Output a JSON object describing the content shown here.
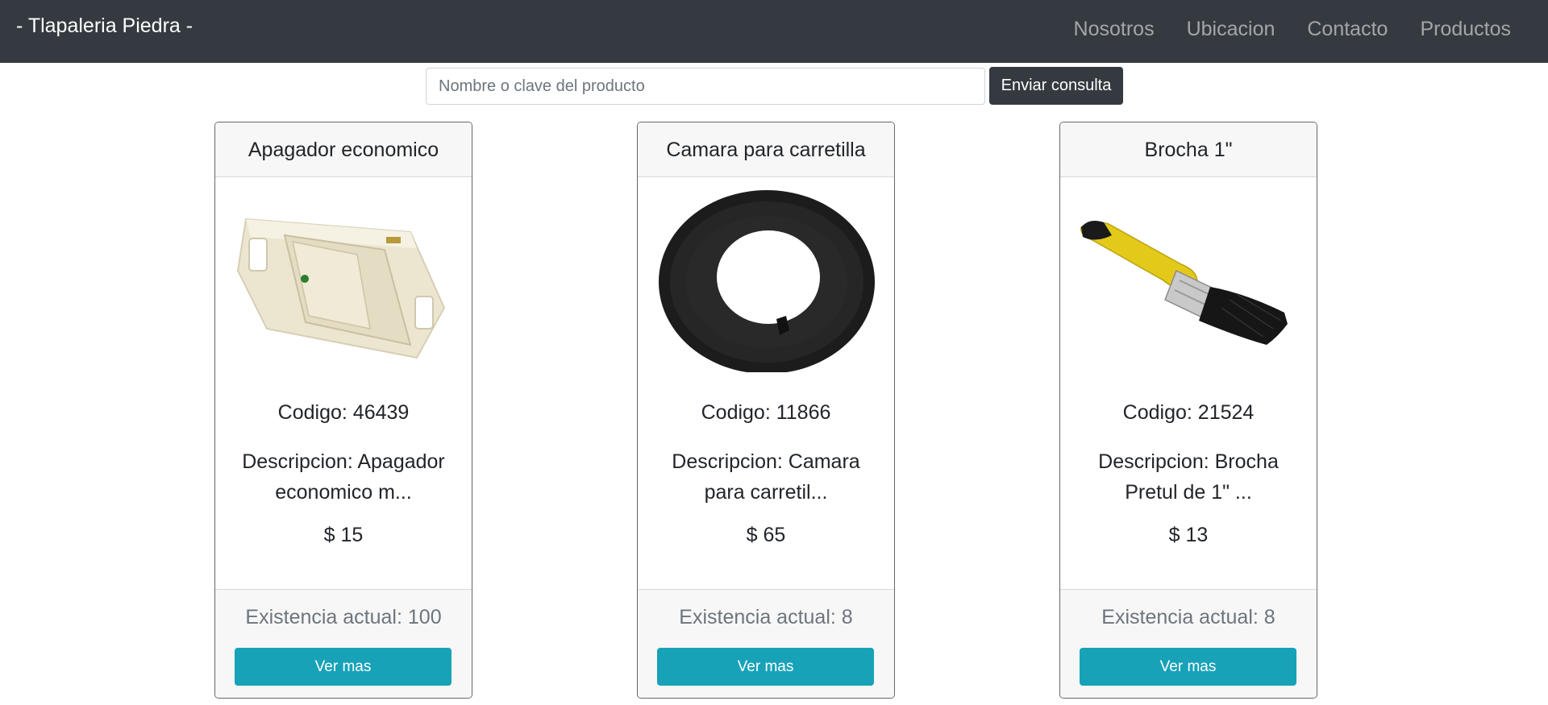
{
  "navbar": {
    "brand": "- Tlapaleria Piedra -",
    "links": [
      "Nosotros",
      "Ubicacion",
      "Contacto",
      "Productos"
    ]
  },
  "search": {
    "placeholder": "Nombre o clave del producto",
    "value": "",
    "button": "Enviar consulta"
  },
  "products": [
    {
      "title": "Apagador economico",
      "image_icon": "light-switch-image",
      "code": "Codigo: 46439",
      "description": "Descripcion: Apagador economico m...",
      "price": "$ 15",
      "stock": "Existencia actual: 100",
      "button": "Ver mas"
    },
    {
      "title": "Camara para carretilla",
      "image_icon": "inner-tube-image",
      "code": "Codigo: 11866",
      "description": "Descripcion: Camara para carretil...",
      "price": "$ 65",
      "stock": "Existencia actual: 8",
      "button": "Ver mas"
    },
    {
      "title": "Brocha 1\"",
      "image_icon": "paint-brush-image",
      "code": "Codigo: 21524",
      "description": "Descripcion: Brocha Pretul de 1\" ...",
      "price": "$ 13",
      "stock": "Existencia actual: 8",
      "button": "Ver mas"
    }
  ],
  "colors": {
    "navbar": "#343a40",
    "info_button": "#17a2b8",
    "card_header": "#f7f7f7"
  }
}
